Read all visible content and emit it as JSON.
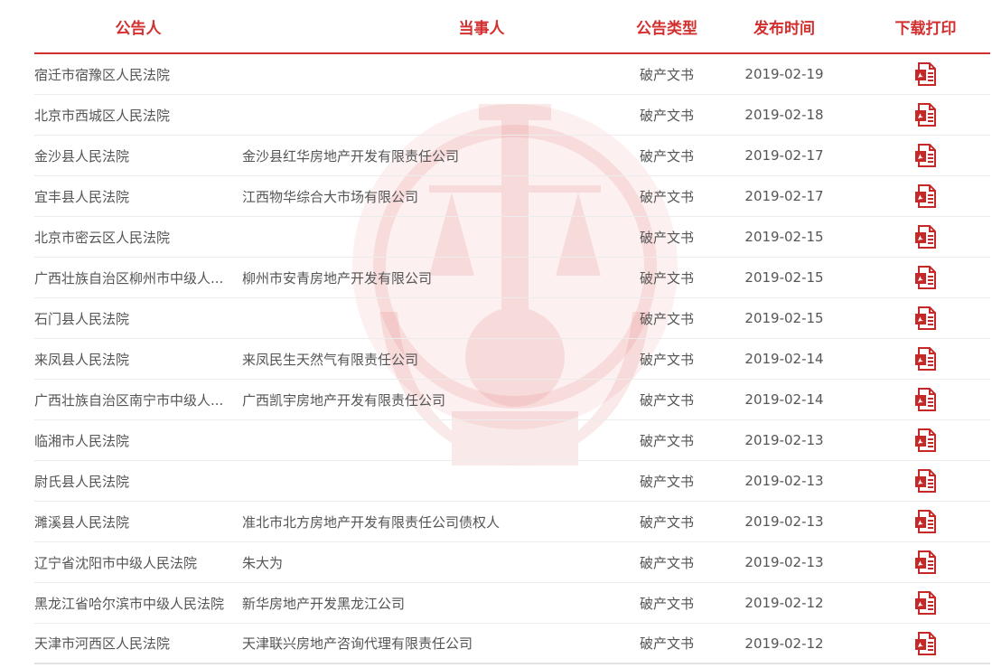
{
  "headers": {
    "court": "公告人",
    "party": "当事人",
    "type": "公告类型",
    "date": "发布时间",
    "download": "下载打印"
  },
  "rows": [
    {
      "court": "宿迁市宿豫区人民法院",
      "party": "",
      "type": "破产文书",
      "date": "2019-02-19",
      "icon": "pdf-icon"
    },
    {
      "court": "北京市西城区人民法院",
      "party": "",
      "type": "破产文书",
      "date": "2019-02-18",
      "icon": "pdf-icon"
    },
    {
      "court": "金沙县人民法院",
      "party": "金沙县红华房地产开发有限责任公司",
      "type": "破产文书",
      "date": "2019-02-17",
      "icon": "pdf-icon"
    },
    {
      "court": "宜丰县人民法院",
      "party": "江西物华综合大市场有限公司",
      "type": "破产文书",
      "date": "2019-02-17",
      "icon": "pdf-icon"
    },
    {
      "court": "北京市密云区人民法院",
      "party": "",
      "type": "破产文书",
      "date": "2019-02-15",
      "icon": "pdf-icon"
    },
    {
      "court": "广西壮族自治区柳州市中级人...",
      "party": "柳州市安青房地产开发有限公司",
      "type": "破产文书",
      "date": "2019-02-15",
      "icon": "pdf-icon"
    },
    {
      "court": "石门县人民法院",
      "party": "",
      "type": "破产文书",
      "date": "2019-02-15",
      "icon": "pdf-icon"
    },
    {
      "court": "来凤县人民法院",
      "party": "来凤民生天然气有限责任公司",
      "type": "破产文书",
      "date": "2019-02-14",
      "icon": "pdf-icon"
    },
    {
      "court": "广西壮族自治区南宁市中级人...",
      "party": "广西凯宇房地产开发有限责任公司",
      "type": "破产文书",
      "date": "2019-02-14",
      "icon": "pdf-icon"
    },
    {
      "court": "临湘市人民法院",
      "party": "",
      "type": "破产文书",
      "date": "2019-02-13",
      "icon": "pdf-icon"
    },
    {
      "court": "尉氏县人民法院",
      "party": "",
      "type": "破产文书",
      "date": "2019-02-13",
      "icon": "pdf-icon"
    },
    {
      "court": "濉溪县人民法院",
      "party": "准北市北方房地产开发有限责任公司债权人",
      "type": "破产文书",
      "date": "2019-02-13",
      "icon": "pdf-icon"
    },
    {
      "court": "辽宁省沈阳市中级人民法院",
      "party": "朱大为",
      "type": "破产文书",
      "date": "2019-02-13",
      "icon": "pdf-icon"
    },
    {
      "court": "黑龙江省哈尔滨市中级人民法院",
      "party": "新华房地产开发黑龙江公司",
      "type": "破产文书",
      "date": "2019-02-12",
      "icon": "pdf-icon"
    },
    {
      "court": "天津市河西区人民法院",
      "party": "天津联兴房地产咨询代理有限责任公司",
      "type": "破产文书",
      "date": "2019-02-12",
      "icon": "pdf-icon"
    }
  ],
  "colors": {
    "accent": "#d32f2f",
    "text": "#555555",
    "divider": "#ececec"
  }
}
